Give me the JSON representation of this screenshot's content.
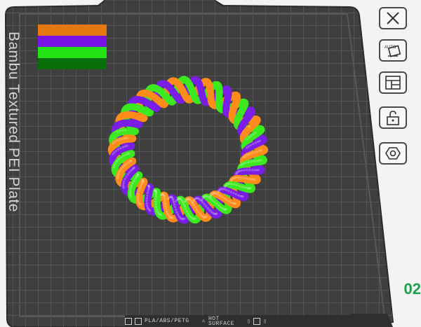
{
  "plate": {
    "title": "Bambu Textured PEI Plate",
    "number": "02",
    "footer_material": "PLA/ABS/PETG",
    "footer_surface_line1": "HOT",
    "footer_surface_line2": "SURFACE"
  },
  "filament_swatches": [
    {
      "color": "#e67810"
    },
    {
      "color": "#7a14e6"
    },
    {
      "color": "#22e214"
    },
    {
      "color": "#086e0a"
    }
  ],
  "model": {
    "name": "twisted ring",
    "colors": [
      "#ff8c1a",
      "#7a1ee6",
      "#3ce81e"
    ]
  },
  "toolbar": {
    "items": [
      {
        "name": "close-plate-button",
        "icon": "close-icon"
      },
      {
        "name": "auto-orient-button",
        "icon": "auto-orient-icon"
      },
      {
        "name": "arrange-button",
        "icon": "arrange-icon"
      },
      {
        "name": "lock-button",
        "icon": "unlock-icon"
      },
      {
        "name": "plate-settings-button",
        "icon": "hex-settings-icon"
      }
    ]
  }
}
